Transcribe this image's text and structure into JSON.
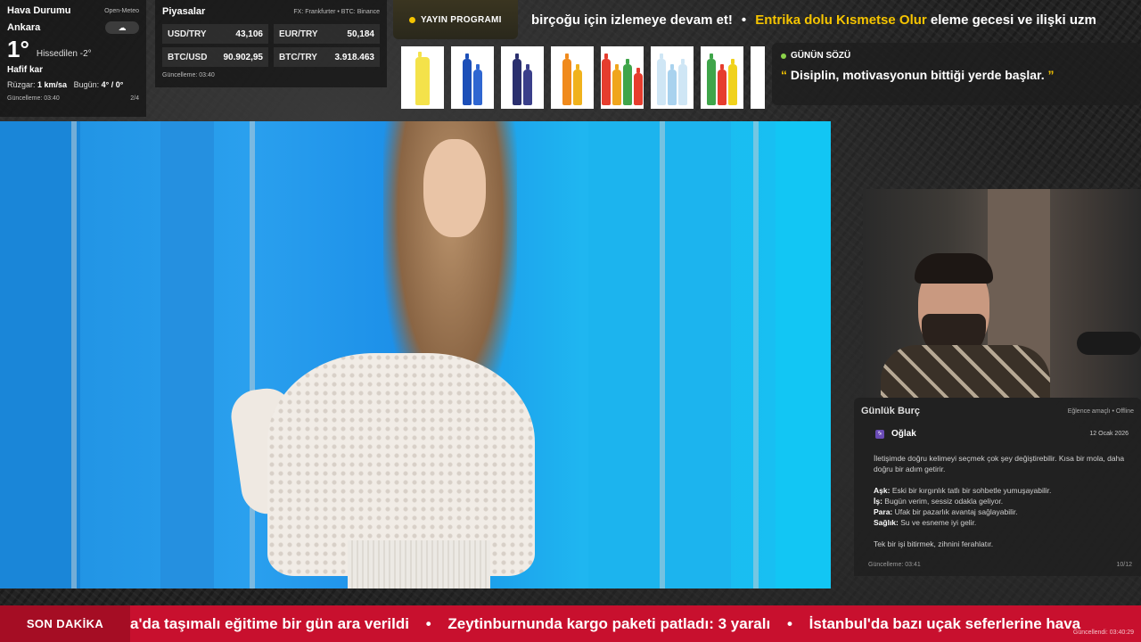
{
  "weather": {
    "title": "Hava Durumu",
    "source": "Open-Meteo",
    "city": "Ankara",
    "icon": "snow-cloud-icon",
    "temperature": "1°",
    "feels_like": "Hissedilen -2°",
    "condition": "Hafif kar",
    "wind_label": "Rüzgar:",
    "wind_value": "1 km/sa",
    "today_label": "Bugün:",
    "today_value": "4° / 0°",
    "updated": "Güncelleme: 03:40",
    "page": "2/4"
  },
  "markets": {
    "title": "Piyasalar",
    "source": "FX: Frankfurter • BTC: Binance",
    "rates": [
      {
        "label": "USD/TRY",
        "value": "43,106"
      },
      {
        "label": "EUR/TRY",
        "value": "50,184"
      },
      {
        "label": "BTC/USD",
        "value": "90.902,95"
      },
      {
        "label": "BTC/TRY",
        "value": "3.918.463"
      }
    ],
    "updated": "Güncelleme: 03:40"
  },
  "program": {
    "label": "YAYIN PROGRAMI",
    "ticker_part1": "birçoğu için izlemeye devam et!",
    "bullet": "•",
    "ticker_highlight": "Entrika dolu Kısmetse Olur",
    "ticker_part2": "eleme gecesi ve ilişki uzm"
  },
  "products": [
    {
      "name": "yellow-soda-bottle",
      "colors": [
        "#f4e24a"
      ]
    },
    {
      "name": "blue-can-pack",
      "colors": [
        "#1c4fb8",
        "#2f66d1"
      ]
    },
    {
      "name": "dark-soda-bottles",
      "colors": [
        "#2a2f6e",
        "#3a3f8a"
      ]
    },
    {
      "name": "orange-soda-bottle",
      "colors": [
        "#f08a1c",
        "#f0b21c"
      ]
    },
    {
      "name": "mixed-soda-bottles",
      "colors": [
        "#e63d2e",
        "#f0a51c",
        "#3fa54a",
        "#e63d2e"
      ]
    },
    {
      "name": "water-bottles",
      "colors": [
        "#cfe6f5",
        "#a9d2ee",
        "#cfe6f5"
      ]
    },
    {
      "name": "green-soda-bottles",
      "colors": [
        "#3fa54a",
        "#e63d2e",
        "#f0d21c"
      ]
    },
    {
      "name": "lime-soda-bottle",
      "colors": [
        "#9bd23a"
      ]
    }
  ],
  "quote": {
    "title": "GÜNÜN SÖZÜ",
    "open_mark": "“",
    "text": "Disiplin, motivasyonun bittiği yerde başlar.",
    "close_mark": "”"
  },
  "horoscope": {
    "title": "Günlük Burç",
    "tag": "Eğlence amaçlı • Offline",
    "sign": "Oğlak",
    "sign_icon": "capricorn-icon",
    "date": "12 Ocak 2026",
    "intro": "İletişimde doğru kelimeyi seçmek çok şey değiştirebilir. Kısa bir mola, daha doğru bir adım getirir.",
    "items": [
      {
        "label": "Aşk:",
        "text": "Eski bir kırgınlık tatlı bir sohbetle yumuşayabilir."
      },
      {
        "label": "İş:",
        "text": "Bugün verim, sessiz odakla geliyor."
      },
      {
        "label": "Para:",
        "text": "Ufak bir pazarlık avantaj sağlayabilir."
      },
      {
        "label": "Sağlık:",
        "text": "Su ve esneme iyi gelir."
      }
    ],
    "closing": "Tek bir işi bitirmek, zihnini ferahlatır.",
    "updated": "Güncelleme: 03:41",
    "page": "10/12"
  },
  "breaking": {
    "label": "SON DAKİKA",
    "item1": "a'da taşımalı eğitime bir gün ara verildi",
    "item2": "Zeytinburnunda kargo paketi patladı: 3 yaralı",
    "item3": "İstanbul'da bazı uçak seferlerine hava",
    "bullet": "•",
    "updated": "Güncellendi: 03:40:29"
  },
  "colors": {
    "accent_yellow": "#f5c400",
    "breaking_red": "#c8102e",
    "quote_dot": "#8bd34a"
  }
}
